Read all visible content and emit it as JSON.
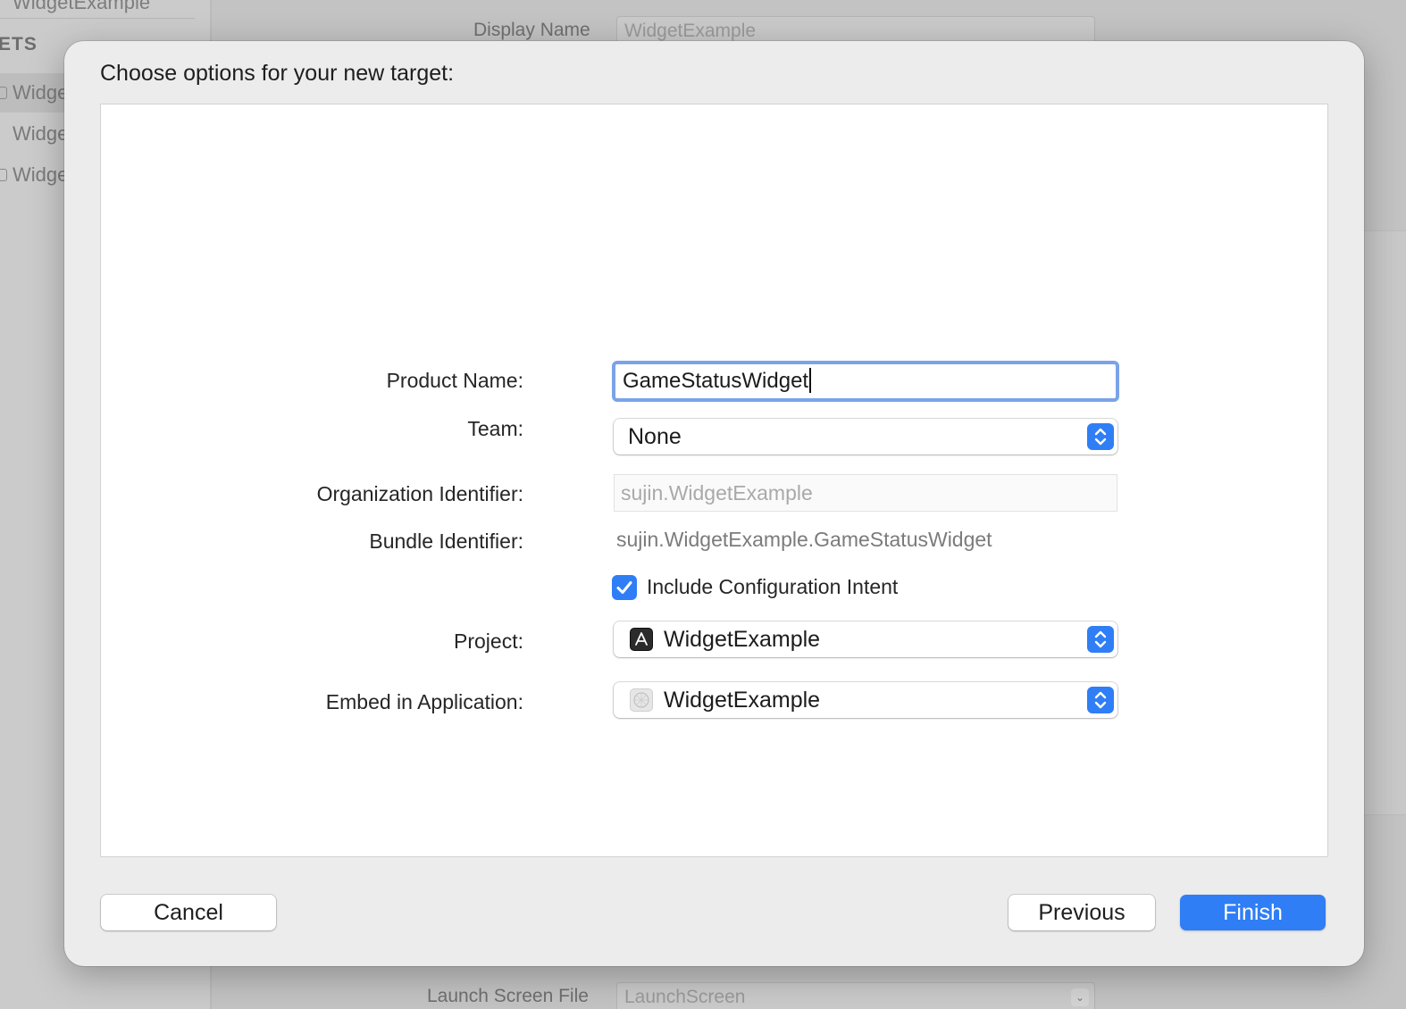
{
  "background": {
    "sidebar": {
      "top_item": "WidgetExample",
      "section_label": "ETS",
      "items": [
        "Widge",
        "Widge",
        "Widge"
      ]
    },
    "main": {
      "display_name_label": "Display Name",
      "display_name_value": "WidgetExample",
      "launch_screen_label": "Launch Screen File",
      "launch_screen_value": "LaunchScreen"
    }
  },
  "sheet": {
    "title": "Choose options for your new target:",
    "form": {
      "product_name_label": "Product Name:",
      "product_name_value": "GameStatusWidget",
      "team_label": "Team:",
      "team_value": "None",
      "org_id_label": "Organization Identifier:",
      "org_id_placeholder": "sujin.WidgetExample",
      "bundle_id_label": "Bundle Identifier:",
      "bundle_id_value": "sujin.WidgetExample.GameStatusWidget",
      "include_intent_label": "Include Configuration Intent",
      "include_intent_checked": true,
      "project_label": "Project:",
      "project_value": "WidgetExample",
      "project_icon": "xcode-project-icon",
      "embed_label": "Embed in Application:",
      "embed_value": "WidgetExample",
      "embed_icon": "app-icon"
    },
    "buttons": {
      "cancel": "Cancel",
      "previous": "Previous",
      "finish": "Finish"
    }
  },
  "colors": {
    "accent": "#2f7ef5",
    "focus_ring": "#7aa3e8"
  }
}
